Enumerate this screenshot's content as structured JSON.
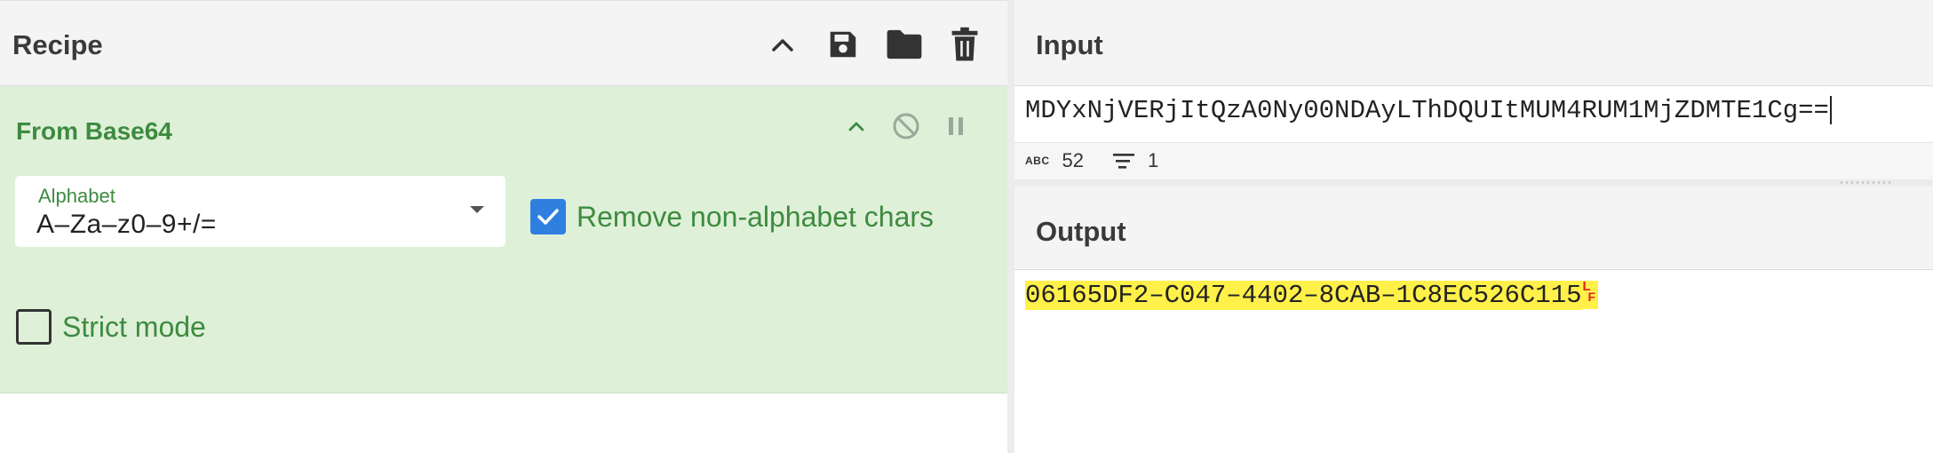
{
  "recipe": {
    "title": "Recipe",
    "operation": {
      "title": "From Base64",
      "alphabet": {
        "label": "Alphabet",
        "value": "A–Za–z0–9+/="
      },
      "remove_non_alphabet": {
        "label": "Remove non-alphabet chars",
        "checked": true
      },
      "strict_mode": {
        "label": "Strict mode",
        "checked": false
      }
    }
  },
  "input": {
    "title": "Input",
    "text": "MDYxNjVERjItQzA0Ny00NDAyLThDQUItMUM4RUM1MjZDMTE1Cg==",
    "status": {
      "abc_icon": "ABC",
      "length": "52",
      "lines": "1"
    }
  },
  "output": {
    "title": "Output",
    "text": "06165DF2–C047–4402–8CAB–1C8EC526C115",
    "control_char": [
      "L",
      "F"
    ]
  },
  "colors": {
    "op_background": "#dff0d8",
    "op_text": "#3d8b40",
    "checkbox": "#2f7fe0",
    "highlight": "#fff04a",
    "control_char": "#e02020"
  },
  "icons": [
    "chevron-up-icon",
    "save-icon",
    "folder-icon",
    "trash-icon",
    "disable-icon",
    "pause-icon",
    "text-length-icon",
    "lines-icon"
  ]
}
